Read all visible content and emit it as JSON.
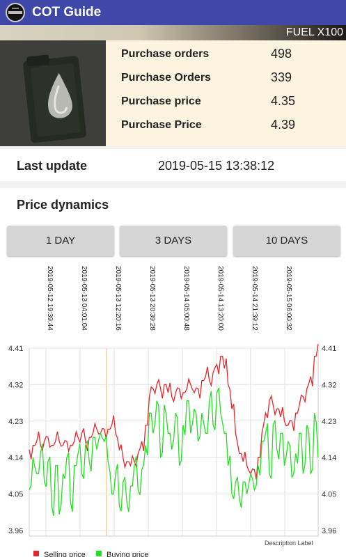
{
  "app": {
    "title": "COT Guide"
  },
  "item": {
    "name": "FUEL X100"
  },
  "stats": [
    {
      "label": "Purchase orders",
      "value": "498"
    },
    {
      "label": "Purchase Orders",
      "value": "339"
    },
    {
      "label": "Purchase price",
      "value": "4.35"
    },
    {
      "label": "Purchase Price",
      "value": "4.39"
    }
  ],
  "last_update": {
    "label": "Last update",
    "value": "2019-05-15 13:38:12"
  },
  "price_dynamics": {
    "title": "Price dynamics",
    "buttons": [
      "1 DAY",
      "3 DAYS",
      "10 DAYS"
    ]
  },
  "chart_data": {
    "type": "line",
    "x_ticks": [
      "2019-05-12 19:39:44",
      "2019-05-13 04:01:04",
      "2019-05-13 12:20:16",
      "2019-05-13 20:39:28",
      "2019-05-14 05:00:48",
      "2019-05-14 13:20:00",
      "2019-05-14 21:39:12",
      "2019-05-15 06:00:32"
    ],
    "y_ticks": [
      "4.41",
      "4.32",
      "4.23",
      "4.14",
      "4.05",
      "3.96"
    ],
    "ylim": [
      3.96,
      4.41
    ],
    "description": "Description Label",
    "legend_position": "bottom-left",
    "series": [
      {
        "name": "Selling price",
        "color": "#e8252a",
        "values": [
          4.16,
          4.17,
          4.18,
          4.17,
          4.18,
          4.19,
          4.17,
          4.18,
          4.18,
          4.17,
          4.18,
          4.17,
          4.18,
          4.19,
          4.2,
          4.18,
          4.19,
          4.2,
          4.21,
          4.2,
          4.21,
          4.21,
          4.22,
          4.2,
          4.16,
          4.14,
          4.13,
          4.12,
          4.13,
          4.15,
          4.18,
          4.22,
          4.29,
          4.31,
          4.32,
          4.31,
          4.32,
          4.3,
          4.29,
          4.3,
          4.31,
          4.3,
          4.31,
          4.32,
          4.3,
          4.31,
          4.33,
          4.34,
          4.33,
          4.35,
          4.37,
          4.39,
          4.36,
          4.32,
          4.26,
          4.2,
          4.15,
          4.13,
          4.12,
          4.1,
          4.11,
          4.14,
          4.2,
          4.25,
          4.28,
          4.27,
          4.26,
          4.24,
          4.23,
          4.22,
          4.23,
          4.25,
          4.27,
          4.29,
          4.31,
          4.34,
          4.39,
          4.42
        ]
      },
      {
        "name": "Buying price",
        "color": "#22e022",
        "values": [
          4.06,
          4.14,
          4.1,
          4.15,
          4.08,
          4.13,
          4.02,
          4.12,
          4.0,
          4.1,
          4.14,
          4.03,
          4.12,
          4.15,
          4.1,
          4.17,
          4.13,
          4.19,
          4.16,
          4.2,
          4.18,
          4.13,
          4.05,
          4.1,
          4.02,
          4.08,
          4.03,
          4.07,
          4.12,
          4.06,
          4.11,
          4.17,
          4.25,
          4.2,
          4.28,
          4.14,
          4.27,
          4.2,
          4.16,
          4.25,
          4.12,
          4.22,
          4.28,
          4.2,
          4.26,
          4.18,
          4.25,
          4.2,
          4.28,
          4.22,
          4.3,
          4.25,
          4.2,
          4.12,
          4.05,
          4.08,
          4.04,
          4.08,
          4.05,
          4.1,
          4.06,
          4.12,
          4.18,
          4.2,
          4.1,
          4.22,
          4.16,
          4.2,
          4.12,
          4.18,
          4.09,
          4.15,
          4.2,
          4.1,
          4.22,
          4.1,
          4.25,
          4.14
        ]
      }
    ]
  }
}
